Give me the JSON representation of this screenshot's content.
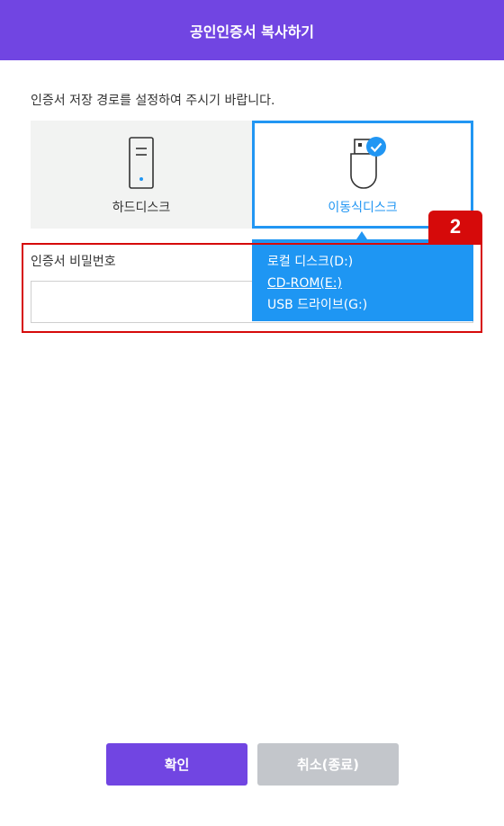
{
  "header": {
    "title": "공인인증서 복사하기"
  },
  "instruction": "인증서 저장 경로를 설정하여 주시기 바랍니다.",
  "storage_options": [
    {
      "label": "하드디스크",
      "icon": "hard-disk-icon",
      "selected": false
    },
    {
      "label": "이동식디스크",
      "icon": "usb-drive-icon",
      "selected": true
    }
  ],
  "step_badge": "2",
  "password": {
    "label": "인증서 비밀번호",
    "value": ""
  },
  "drives": [
    {
      "label": "로컬 디스크(D:)",
      "selected": false
    },
    {
      "label": "CD-ROM(E:)",
      "selected": true
    },
    {
      "label": "USB 드라이브(G:)",
      "selected": false
    }
  ],
  "buttons": {
    "confirm": "확인",
    "cancel": "취소(종료)"
  },
  "colors": {
    "primary": "#7145e2",
    "accent": "#2196f3",
    "highlight": "#d60a0a",
    "disabled": "#c3c6cb"
  }
}
